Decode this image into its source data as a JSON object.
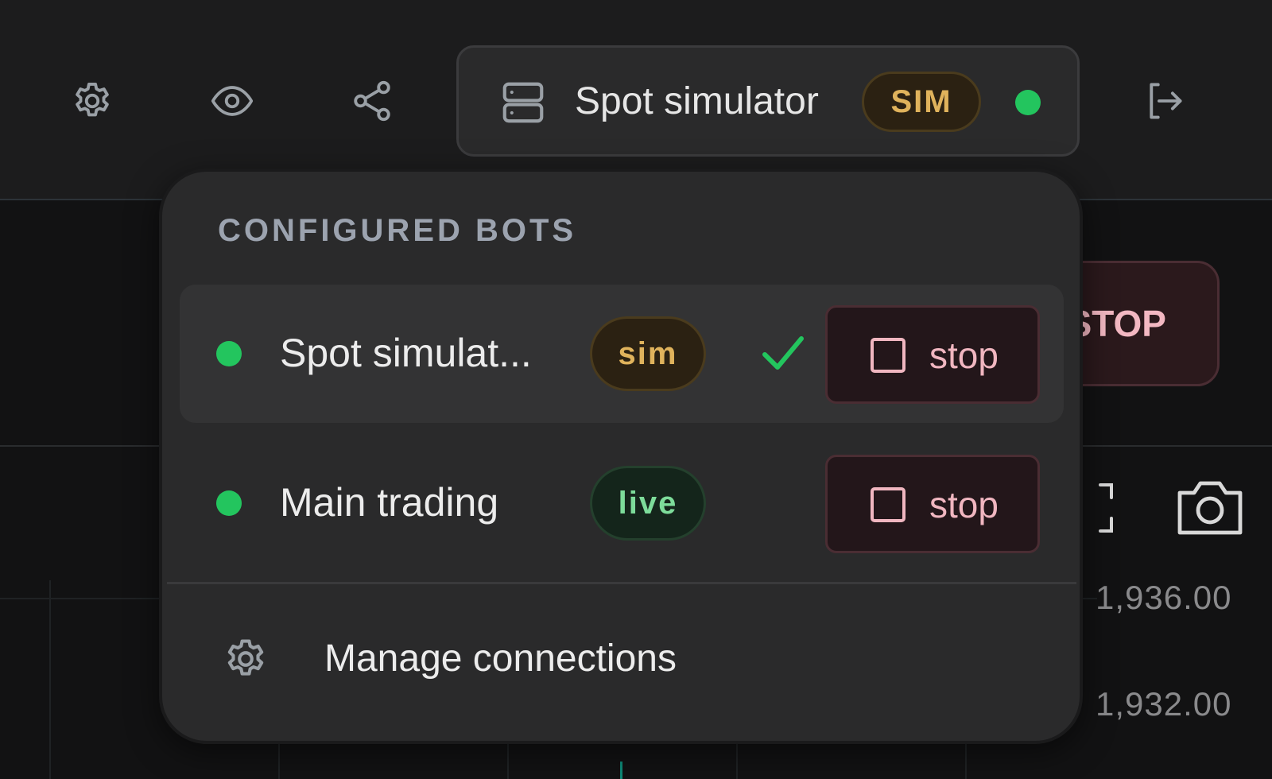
{
  "header": {
    "icons": [
      "settings-icon",
      "eye-icon",
      "share-icon",
      "logout-icon"
    ],
    "selector": {
      "icon": "server-icon",
      "name": "Spot simulator",
      "badge": "SIM",
      "status_color": "#23c55e"
    }
  },
  "background": {
    "stop_button_label": "STOP",
    "prices": [
      "1,936.00",
      "1,932.00"
    ]
  },
  "dropdown": {
    "heading": "CONFIGURED BOTS",
    "bots": [
      {
        "name": "Spot simulat...",
        "badge": "sim",
        "selected": true,
        "status_color": "#23c55e",
        "stop_label": "stop"
      },
      {
        "name": "Main trading",
        "badge": "live",
        "selected": false,
        "status_color": "#23c55e",
        "stop_label": "stop"
      }
    ],
    "manage_label": "Manage connections"
  },
  "colors": {
    "accent_green": "#23c55e",
    "sim_badge": "#e0b35c",
    "live_badge": "#7ddc9a",
    "stop_text": "#f0b6c0"
  }
}
